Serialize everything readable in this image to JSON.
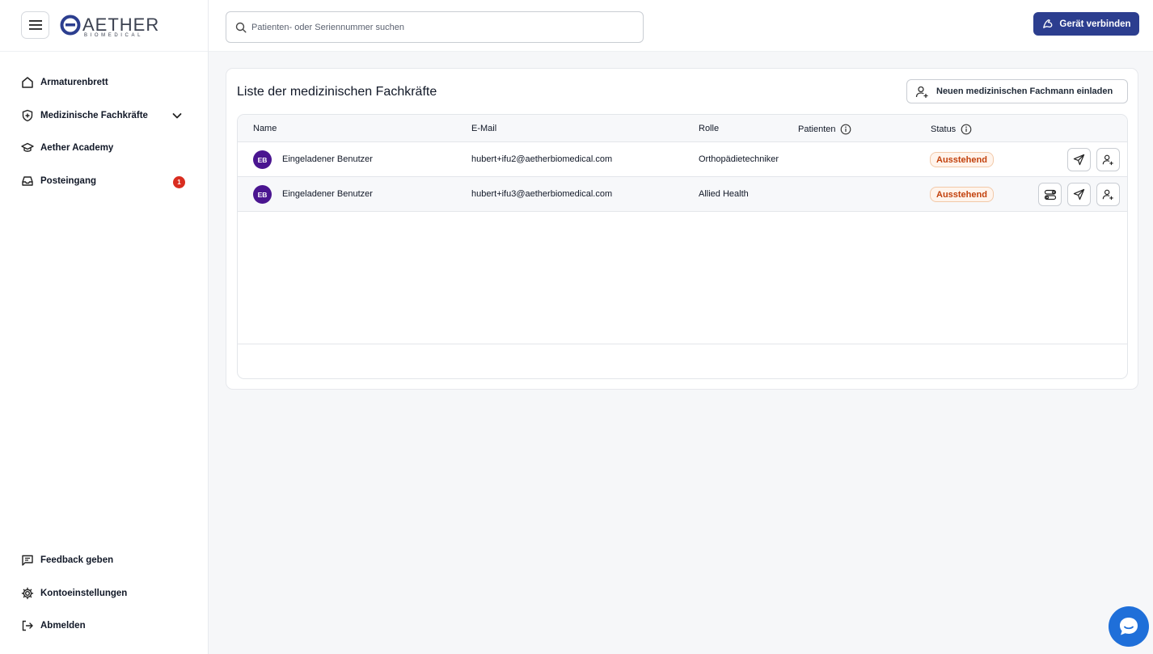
{
  "brand": {
    "name": "AETHER",
    "sub": "BIOMEDICAL"
  },
  "sidebar": {
    "items": [
      {
        "label": "Armaturenbrett",
        "icon": "home-icon"
      },
      {
        "label": "Medizinische Fachkräfte",
        "icon": "shield-plus-icon",
        "expandable": true
      },
      {
        "label": "Aether Academy",
        "icon": "graduation-cap-icon"
      },
      {
        "label": "Posteingang",
        "icon": "inbox-icon",
        "badge": "1"
      }
    ],
    "bottom_items": [
      {
        "label": "Feedback geben",
        "icon": "message-square-icon"
      },
      {
        "label": "Kontoeinstellungen",
        "icon": "gear-icon"
      },
      {
        "label": "Abmelden",
        "icon": "logout-icon"
      }
    ]
  },
  "header": {
    "search_placeholder": "Patienten- oder Seriennummer suchen",
    "connect_label": "Gerät verbinden"
  },
  "main": {
    "title": "Liste der medizinischen Fachkräfte",
    "invite_label": "Neuen medizinischen Fachmann einladen",
    "columns": [
      "Name",
      "E-Mail",
      "Rolle",
      "Patienten",
      "Status"
    ],
    "rows": [
      {
        "initials": "EB",
        "name": "Eingeladener Benutzer",
        "email": "hubert+ifu2@aetherbiomedical.com",
        "role": "Orthopädietechniker",
        "patients": "",
        "status": "Ausstehend"
      },
      {
        "initials": "EB",
        "name": "Eingeladener Benutzer",
        "email": "hubert+ifu3@aetherbiomedical.com",
        "role": "Allied Health",
        "patients": "",
        "status": "Ausstehend"
      }
    ]
  },
  "colors": {
    "primary": "#2c3e8f",
    "avatar": "#4a1590",
    "status_text": "#c2410c",
    "badge": "#d92d20",
    "chat": "#1f6fd9"
  }
}
